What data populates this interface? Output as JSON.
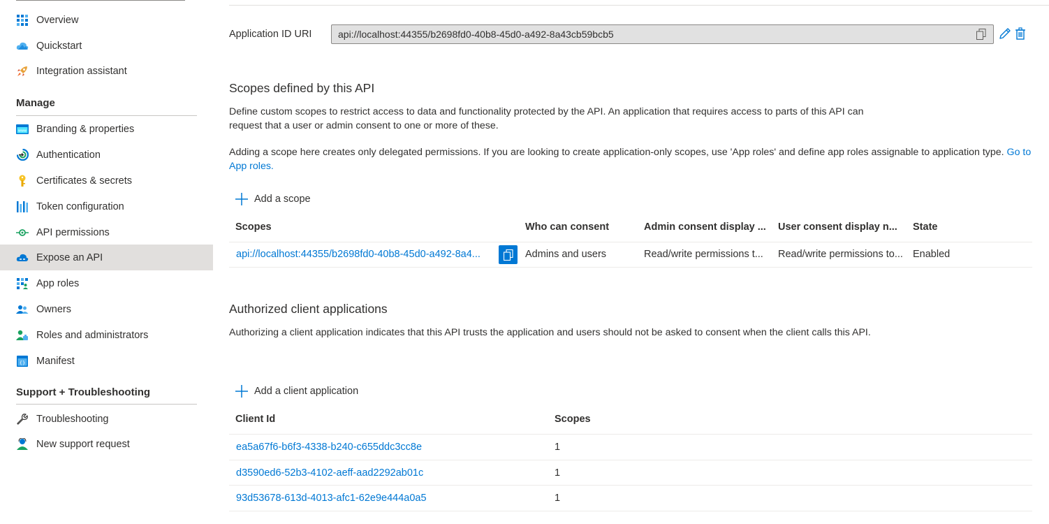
{
  "sidebar": {
    "top_items": [
      {
        "label": "Overview",
        "icon": "grid-icon"
      },
      {
        "label": "Quickstart",
        "icon": "cloud-icon"
      },
      {
        "label": "Integration assistant",
        "icon": "rocket-icon"
      }
    ],
    "manage_heading": "Manage",
    "manage_items": [
      {
        "label": "Branding & properties",
        "icon": "branding-icon"
      },
      {
        "label": "Authentication",
        "icon": "authentication-icon"
      },
      {
        "label": "Certificates & secrets",
        "icon": "key-icon"
      },
      {
        "label": "Token configuration",
        "icon": "token-bars-icon"
      },
      {
        "label": "API permissions",
        "icon": "api-permissions-icon"
      },
      {
        "label": "Expose an API",
        "icon": "cloud-api-icon",
        "active": true
      },
      {
        "label": "App roles",
        "icon": "app-roles-icon"
      },
      {
        "label": "Owners",
        "icon": "owners-icon"
      },
      {
        "label": "Roles and administrators",
        "icon": "roles-admins-icon"
      },
      {
        "label": "Manifest",
        "icon": "manifest-icon"
      }
    ],
    "support_heading": "Support + Troubleshooting",
    "support_items": [
      {
        "label": "Troubleshooting",
        "icon": "wrench-icon"
      },
      {
        "label": "New support request",
        "icon": "support-person-icon"
      }
    ]
  },
  "main": {
    "app_id_uri_label": "Application ID URI",
    "app_id_uri_value": "api://localhost:44355/b2698fd0-40b8-45d0-a492-8a43cb59bcb5",
    "scopes_section": {
      "title": "Scopes defined by this API",
      "description_1": "Define custom scopes to restrict access to data and functionality protected by the API. An application that requires access to parts of this API can request that a user or admin consent to one or more of these.",
      "description_2": "Adding a scope here creates only delegated permissions. If you are looking to create application-only scopes, use 'App roles' and define app roles assignable to application type.",
      "description_2_link": "Go to App roles.",
      "add_label": "Add a scope",
      "columns": [
        "Scopes",
        "Who can consent",
        "Admin consent display ...",
        "User consent display n...",
        "State"
      ],
      "rows": [
        {
          "scope": "api://localhost:44355/b2698fd0-40b8-45d0-a492-8a4...",
          "who_can_consent": "Admins and users",
          "admin_display": "Read/write permissions t...",
          "user_display": "Read/write permissions to...",
          "state": "Enabled"
        }
      ]
    },
    "clients_section": {
      "title": "Authorized client applications",
      "description": "Authorizing a client application indicates that this API trusts the application and users should not be asked to consent when the client calls this API.",
      "add_label": "Add a client application",
      "columns": [
        "Client Id",
        "Scopes"
      ],
      "rows": [
        {
          "client_id": "ea5a67f6-b6f3-4338-b240-c655ddc3cc8e",
          "scopes": "1"
        },
        {
          "client_id": "d3590ed6-52b3-4102-aeff-aad2292ab01c",
          "scopes": "1"
        },
        {
          "client_id": "93d53678-613d-4013-afc1-62e9e444a0a5",
          "scopes": "1"
        }
      ]
    }
  },
  "colors": {
    "accent": "#0078d4",
    "active_bg": "#e1dfdd",
    "text": "#323130"
  }
}
